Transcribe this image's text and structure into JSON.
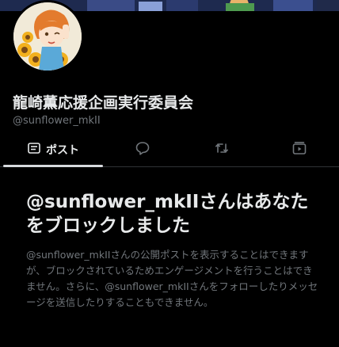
{
  "profile": {
    "display_name": "龍崎薫応援企画実行委員会",
    "handle": "@sunflower_mkII",
    "avatar_icon": "sunflower-avatar"
  },
  "tabs": [
    {
      "label": "ポスト",
      "icon": "posts-icon",
      "selected": true
    },
    {
      "label": "",
      "icon": "reply-icon",
      "selected": false
    },
    {
      "label": "",
      "icon": "repost-icon",
      "selected": false
    },
    {
      "label": "",
      "icon": "media-icon",
      "selected": false
    }
  ],
  "block_notice": {
    "title": "@sunflower_mkIIさんはあなたをブロックしました",
    "description": "@sunflower_mkIIさんの公開ポストを表示することはできますが、ブロックされているためエンゲージメントを行うことはできません。さらに、@sunflower_mkIIさんをフォローしたりメッセージを送信したりすることもできません。"
  },
  "colors": {
    "background": "#000000",
    "text_primary": "#e7e9ea",
    "text_secondary": "#71767b",
    "divider": "#2f3336",
    "tab_indicator": "#d7dade"
  }
}
